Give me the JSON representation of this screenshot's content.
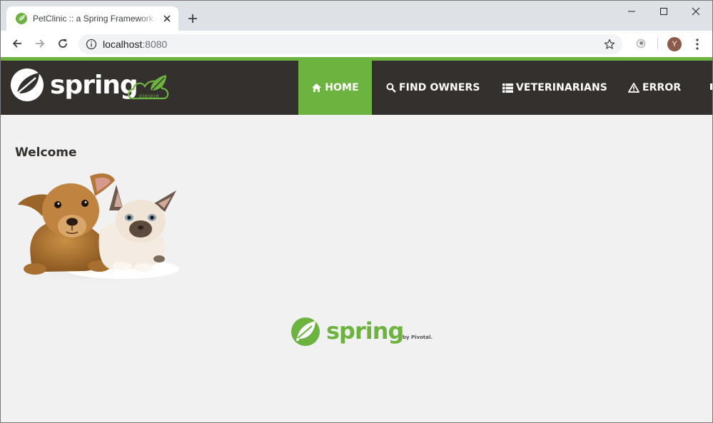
{
  "browser": {
    "tab_title": "PetClinic :: a Spring Framework demonstration",
    "url_host": "localhost",
    "url_port": ":8080",
    "avatar_letter": "Y"
  },
  "brand": {
    "logo_text": "spring",
    "badge_digits": "0101010"
  },
  "nav": {
    "items": [
      {
        "label": "HOME",
        "icon": "home-icon",
        "active": true
      },
      {
        "label": "FIND OWNERS",
        "icon": "search-icon",
        "active": false
      },
      {
        "label": "VETERINARIANS",
        "icon": "list-icon",
        "active": false
      },
      {
        "label": "ERROR",
        "icon": "warning-icon",
        "active": false
      }
    ]
  },
  "main": {
    "heading": "Welcome"
  },
  "footer": {
    "logo_text": "spring",
    "byline": "by Pivotal."
  },
  "colors": {
    "spring_green": "#6db33f",
    "navbar_dark": "#34302d",
    "page_background": "#f1f1f1",
    "tab_strip": "#dee1e6"
  }
}
